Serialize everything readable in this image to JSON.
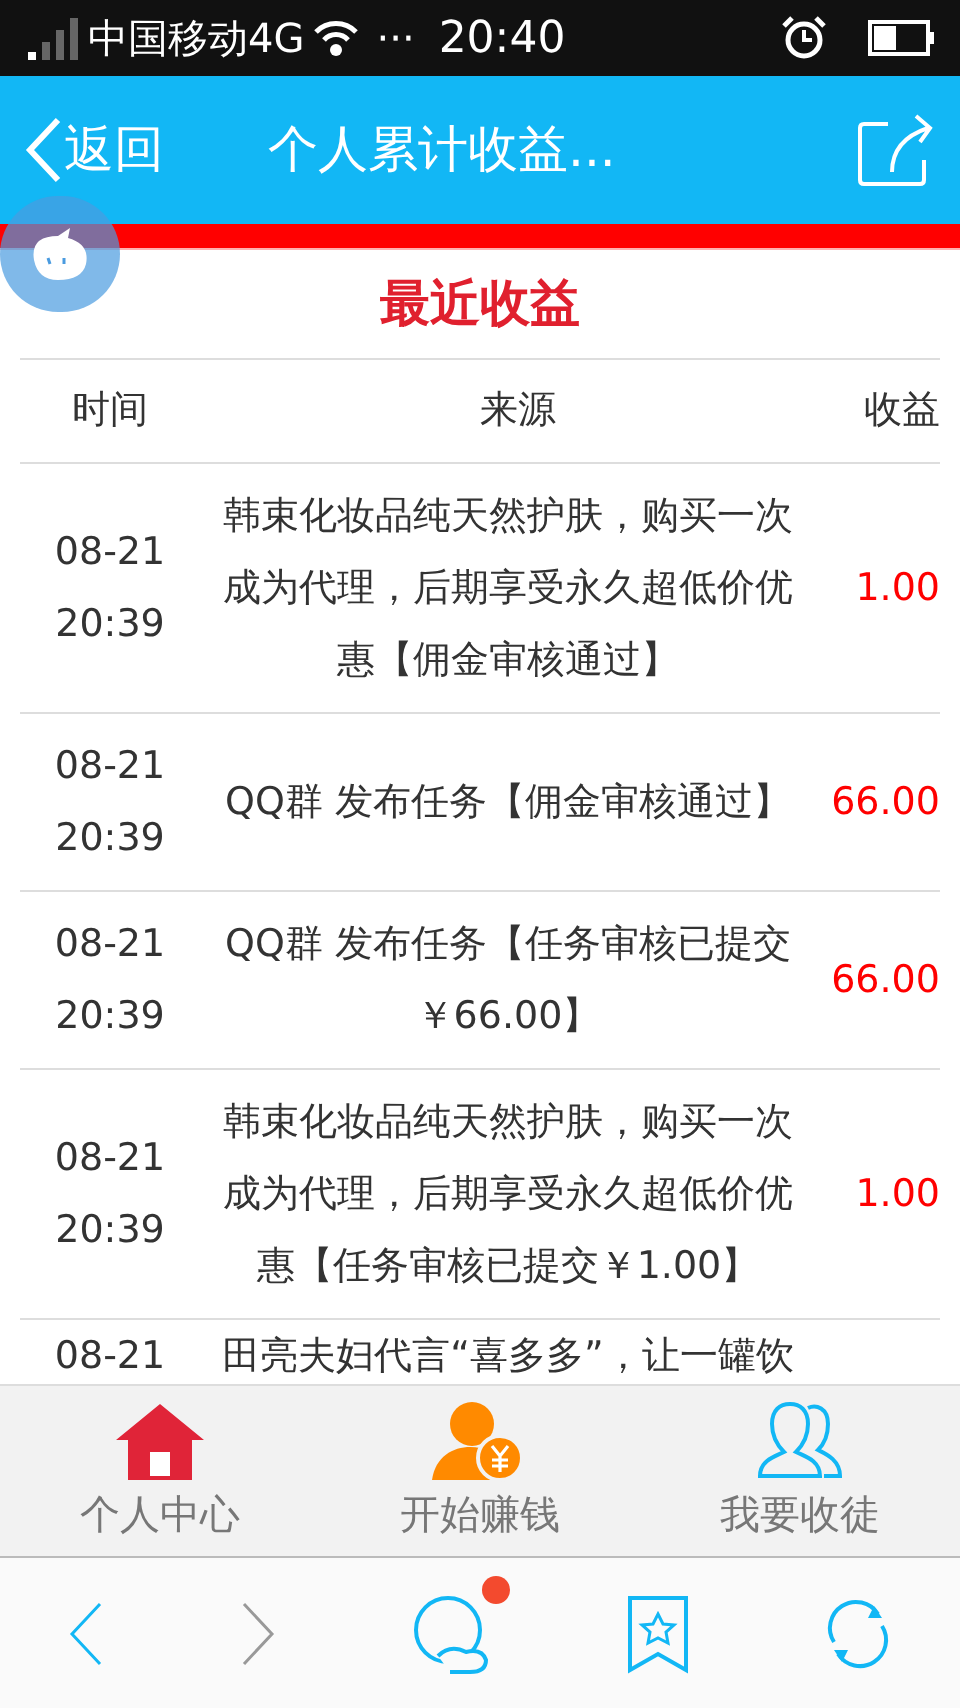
{
  "status_bar": {
    "carrier": "中国移动4G",
    "dots": "···",
    "time": "20:40"
  },
  "header": {
    "back": "返回",
    "title": "个人累计收益..."
  },
  "section_title": "最近收益",
  "table": {
    "columns": [
      "时间",
      "来源",
      "收益"
    ],
    "rows": [
      {
        "date": "08-21",
        "time": "20:39",
        "source": "韩束化妆品纯天然护肤，购买一次成为代理，后期享受永久超低价优惠【佣金审核通过】",
        "amount": "1.00"
      },
      {
        "date": "08-21",
        "time": "20:39",
        "source": "QQ群 发布任务【佣金审核通过】",
        "amount": "66.00"
      },
      {
        "date": "08-21",
        "time": "20:39",
        "source": "QQ群 发布任务【任务审核已提交￥66.00】",
        "amount": "66.00"
      },
      {
        "date": "08-21",
        "time": "20:39",
        "source": "韩束化妆品纯天然护肤，购买一次成为代理，后期享受永久超低价优惠【任务审核已提交￥1.00】",
        "amount": "1.00"
      },
      {
        "date": "08-21",
        "source": "田亮夫妇代言“喜多多”，让一罐饮"
      }
    ]
  },
  "bottom_nav": [
    {
      "label": "个人中心",
      "kind": "home"
    },
    {
      "label": "开始赚钱",
      "kind": "earn"
    },
    {
      "label": "我要收徒",
      "kind": "users"
    }
  ],
  "browser_bar": {
    "forward_disabled": true,
    "notification": true
  }
}
